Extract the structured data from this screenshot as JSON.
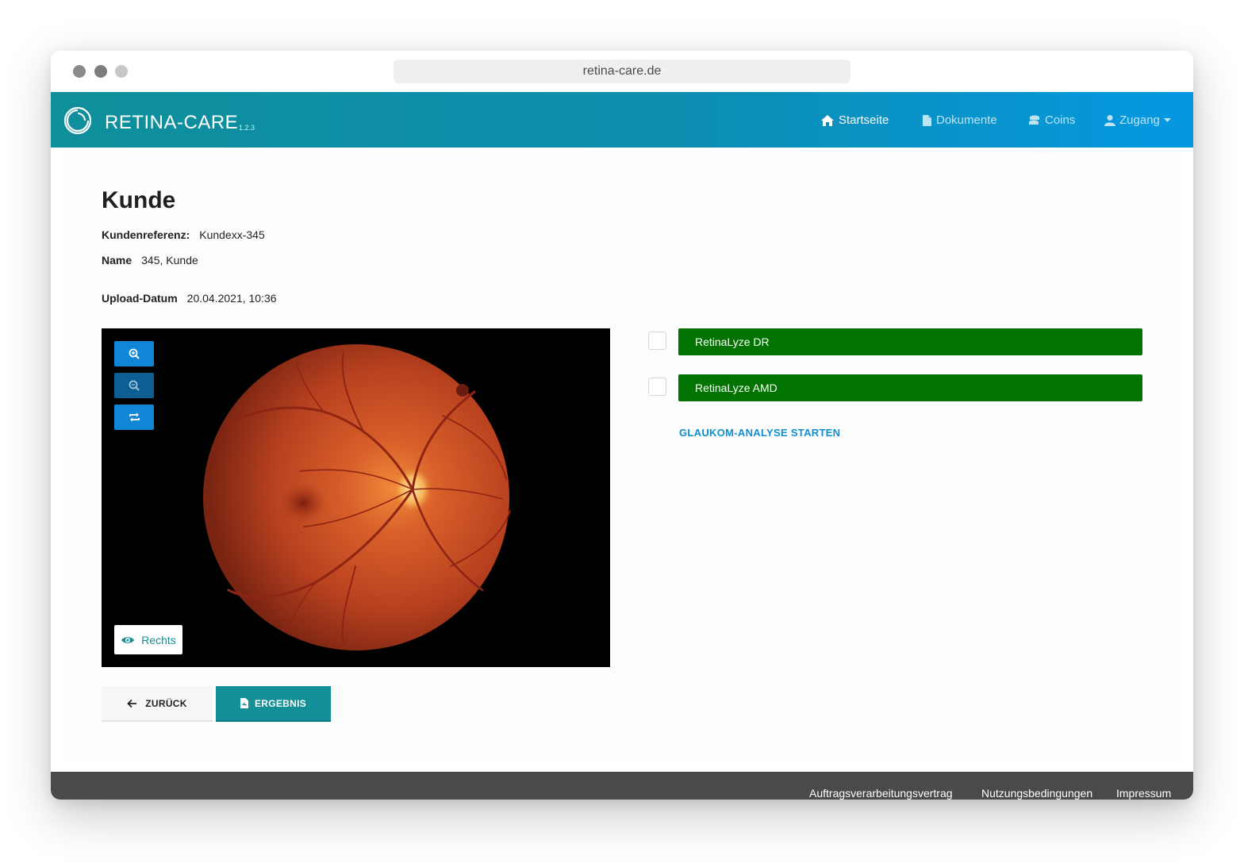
{
  "browser": {
    "url": "retina-care.de"
  },
  "navbar": {
    "brand": "RETINA-CARE",
    "version": "1.2.3",
    "items": [
      {
        "label": "Startseite",
        "icon": "home-icon",
        "active": true
      },
      {
        "label": "Dokumente",
        "icon": "document-icon",
        "active": false
      },
      {
        "label": "Coins",
        "icon": "coins-icon",
        "active": false
      },
      {
        "label": "Zugang",
        "icon": "user-icon",
        "active": false,
        "dropdown": true
      }
    ]
  },
  "customer": {
    "title": "Kunde",
    "reference_label": "Kundenreferenz:",
    "reference_value": "Kundexx-345",
    "name_label": "Name",
    "name_value": "345, Kunde",
    "upload_label": "Upload-Datum",
    "upload_value": "20.04.2021, 10:36"
  },
  "viewer": {
    "tools": [
      "zoom-in-icon",
      "zoom-out-icon",
      "flip-icon"
    ],
    "eye_side": "Rechts"
  },
  "actions": {
    "back_label": "ZURÜCK",
    "result_label": "ERGEBNIS"
  },
  "analyses": {
    "options": [
      {
        "label": "RetinaLyze DR",
        "checked": false
      },
      {
        "label": "RetinaLyze AMD",
        "checked": false
      }
    ],
    "glaukom_link": "GLAUKOM-ANALYSE STARTEN"
  },
  "footer": {
    "links": [
      "Auftragsverarbeitungsvertrag",
      "Nutzungsbedingungen",
      "Impressum"
    ]
  },
  "colors": {
    "navbar_start": "#0e8f9a",
    "navbar_end": "#0598e2",
    "primary_teal": "#128f97",
    "algo_green": "#007300",
    "link_blue": "#0f8fcf",
    "footer": "#4a4a4c"
  }
}
